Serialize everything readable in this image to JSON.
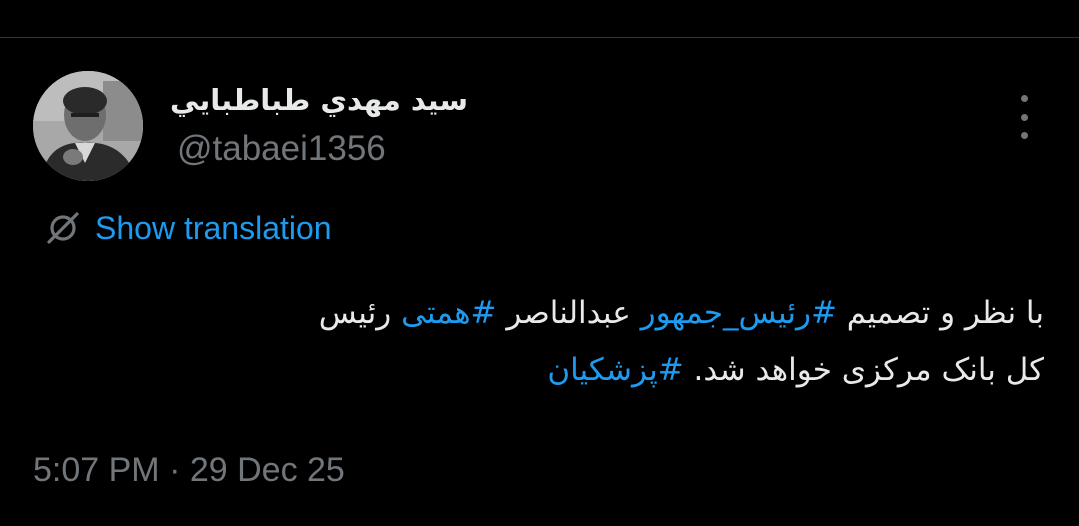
{
  "author": {
    "display_name": "سيد مهدي طباطبايي",
    "handle": "@tabaei1356"
  },
  "translate": {
    "icon": "translate-icon",
    "label": "Show translation"
  },
  "more": {
    "icon": "more-vertical-icon"
  },
  "tweet": {
    "line1_text_a": "با نظر و تصمیم ",
    "hashtag1": "#رئیس_جمهور",
    "line1_text_b": " عبدالناصر ",
    "hashtag2": "#همتی",
    "line1_text_c": " رئیس",
    "line2_text": "کل بانک مرکزی خواهد شد. ",
    "hashtag3": "#پزشکیان"
  },
  "timestamp": {
    "time": "5:07 PM",
    "separator": " · ",
    "date": "29 Dec 25"
  },
  "colors": {
    "background": "#000000",
    "text": "#e7e9ea",
    "secondary": "#71767b",
    "accent": "#1d9bf0",
    "divider": "#2f3336"
  }
}
